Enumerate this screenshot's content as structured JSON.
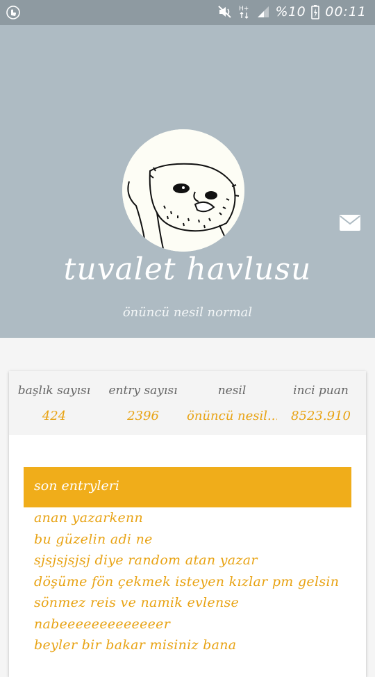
{
  "status_bar": {
    "battery_pct": "%10",
    "time": "00:11",
    "icons": [
      "touch-icon",
      "mute-icon",
      "data-arrows-icon",
      "signal-icon",
      "battery-charging-icon"
    ]
  },
  "profile": {
    "username": "tuvalet havlusu",
    "generation_label": "önüncü nesil normal",
    "avatar": "derp-face-avatar",
    "message_icon": "envelope-icon"
  },
  "stats": [
    {
      "label": "başlık sayısı",
      "value": "424"
    },
    {
      "label": "entry sayısı",
      "value": "2396"
    },
    {
      "label": "nesil",
      "value": "önüncü nesil..."
    },
    {
      "label": "inci puan",
      "value": "8523.910"
    }
  ],
  "entries": {
    "title": "son entryleri",
    "items": [
      "anan yazarkenn",
      "bu güzelin adi ne",
      "sjsjsjsjsj diye random atan yazar",
      "döşüme fön çekmek isteyen kızlar pm gelsin",
      "sönmez reis ve namik evlense",
      "nabeeeeeeeeeeeeer",
      "beyler bir bakar misiniz bana"
    ]
  },
  "colors": {
    "header_bg": "#aebbc3",
    "accent": "#f0ad1a",
    "value_text": "#e8a314"
  }
}
